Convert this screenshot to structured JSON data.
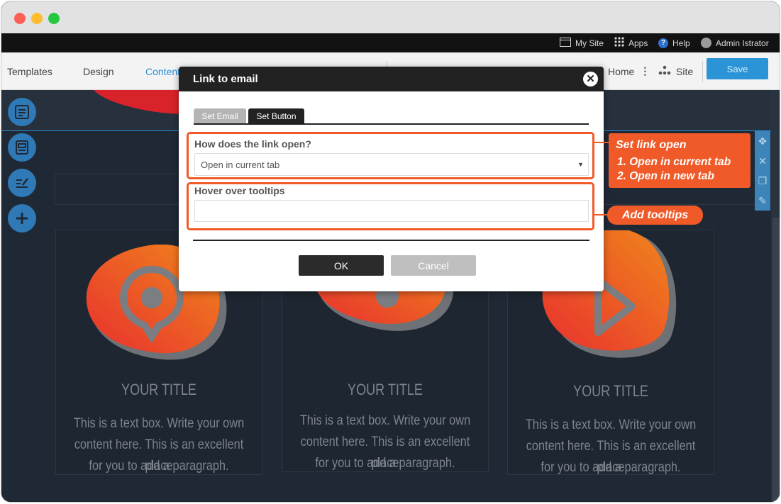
{
  "topbar": {
    "my_site": "My Site",
    "apps": "Apps",
    "help": "Help",
    "user": "Admin Istrator"
  },
  "editorbar": {
    "nav": [
      "Templates",
      "Design",
      "Content"
    ],
    "page_select": "Home",
    "site": "Site",
    "save": "Save"
  },
  "cards": [
    {
      "title": "YOUR TITLE",
      "lines": [
        "This is a text box. Write your own",
        "content here. This is an excellent place",
        "for you to add a paragraph."
      ],
      "icon": "location-pin-icon"
    },
    {
      "title": "YOUR TITLE",
      "lines": [
        "This is a text box. Write your own",
        "content here. This is an excellent place",
        "for you to add a paragraph."
      ],
      "icon": "info-icon"
    },
    {
      "title": "YOUR TITLE",
      "lines": [
        "This is a text box. Write your own",
        "content here. This is an excellent place",
        "for you to add a paragraph."
      ],
      "icon": "play-icon"
    }
  ],
  "modal": {
    "title": "Link to email",
    "tabs": [
      "Set Email",
      "Set Button"
    ],
    "active_tab": "Set Button",
    "link_open_label": "How does the link open?",
    "link_open_value": "Open in current tab",
    "tooltip_label": "Hover over tooltips",
    "tooltip_value": "",
    "ok": "OK",
    "cancel": "Cancel"
  },
  "callouts": {
    "set_link_title": "Set link open",
    "set_link_opt1": "1. Open in current tab",
    "set_link_opt2": "2. Open in new tab",
    "tooltips": "Add tooltips"
  },
  "colors": {
    "accent": "#f05a28",
    "primary": "#2a94d6",
    "modal_header": "#222222",
    "blob_start": "#e8302e",
    "blob_end": "#f0861c"
  }
}
